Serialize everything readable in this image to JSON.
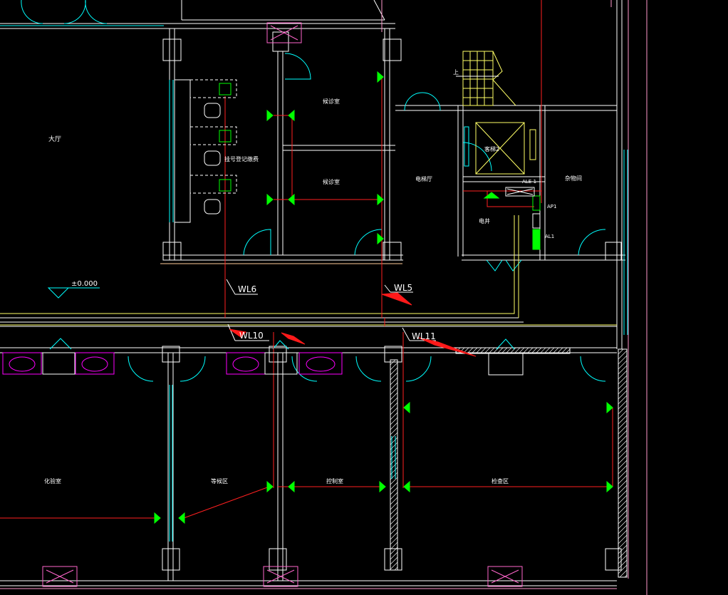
{
  "drawing": {
    "background": "#000000",
    "colors": {
      "wall": "#ffffff",
      "window": "#00ffff",
      "wire": "#ff2020",
      "fixture": "#00ff00",
      "sanitary": "#ff00ff",
      "accent_yellow": "#ffff66",
      "pink_line": "#ff99cc",
      "arrow": "#ff1a1a"
    },
    "rooms": {
      "hall": "大厅",
      "wait_room_1": "候诊室",
      "wait_room_2": "候诊室",
      "register": "挂号登记缴费",
      "elevator_hall": "电梯厅",
      "elevator": "客梯2",
      "utility": "杂物间",
      "shaft": "电井",
      "lab": "化验室",
      "waiting_area": "等候区",
      "control_room": "控制室",
      "inspection_area": "检查区"
    },
    "level_mark": "±0.000",
    "stair_label": "上",
    "panels": {
      "ale1": "ALE-1",
      "ap1": "AP1",
      "al1": "AL1"
    },
    "circuits": {
      "wl6": "WL6",
      "wl5": "WL5",
      "wl10": "WL10",
      "wl11": "WL11"
    }
  }
}
